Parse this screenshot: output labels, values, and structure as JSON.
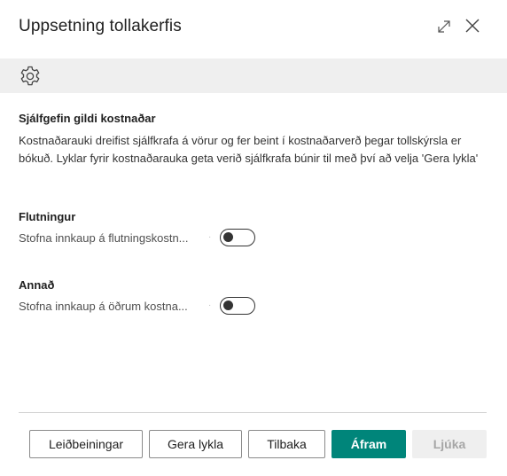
{
  "dialog": {
    "title": "Uppsetning tollakerfis"
  },
  "section": {
    "title": "Sjálfgefin gildi kostnaðar",
    "description": "Kostnaðarauki dreifist sjálfkrafa á vörur og fer beint í kostnaðarverð þegar tollskýrsla er bókuð. Lyklar fyrir kostnaðarauka geta verið sjálfkrafa búnir til með því að velja 'Gera lykla'"
  },
  "groups": [
    {
      "title": "Flutningur",
      "field_label": "Stofna innkaup á flutningskostn...",
      "toggle_on": false
    },
    {
      "title": "Annað",
      "field_label": "Stofna innkaup á öðrum kostna...",
      "toggle_on": false
    }
  ],
  "footer": {
    "guide_label": "Leiðbeiningar",
    "create_keys_label": "Gera lykla",
    "back_label": "Tilbaka",
    "next_label": "Áfram",
    "finish_label": "Ljúka"
  },
  "icons": {
    "expand": "expand-icon",
    "close": "close-icon",
    "settings": "gear-icon"
  },
  "colors": {
    "primary": "#00857a",
    "toolbar_bg": "#efefef",
    "disabled_bg": "#efefef"
  }
}
